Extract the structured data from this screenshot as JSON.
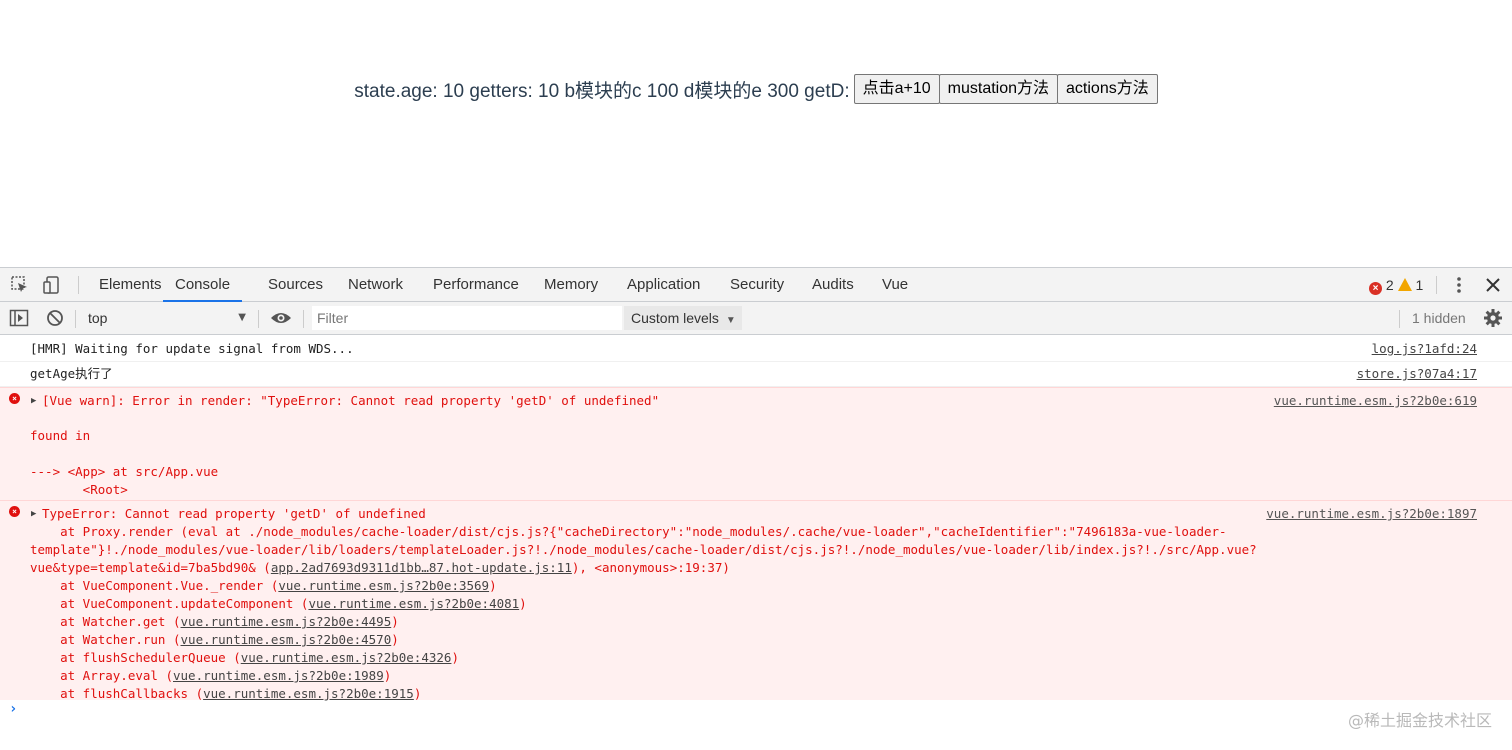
{
  "app": {
    "text": "state.age: 10 getters: 10 b模块的c 100 d模块的e 300 getD:",
    "buttons": [
      "点击a+10",
      "mustation方法",
      "actions方法"
    ]
  },
  "devtools": {
    "tabs": [
      "Elements",
      "Console",
      "Sources",
      "Network",
      "Performance",
      "Memory",
      "Application",
      "Security",
      "Audits",
      "Vue"
    ],
    "active_tab": "Console",
    "issues": {
      "errors": "2",
      "warnings": "1"
    },
    "toolbar": {
      "context": "top",
      "filter_placeholder": "Filter",
      "levels": "Custom levels",
      "hidden": "1 hidden"
    },
    "colors": {
      "error": "#e0100e",
      "error_bg": "#fff0f0",
      "accent": "#1a73e8",
      "warning": "#f2a600"
    },
    "messages": [
      {
        "type": "log",
        "text": "[HMR] Waiting for update signal from WDS...",
        "source": "log.js?1afd:24"
      },
      {
        "type": "log",
        "text": "getAge执行了",
        "source": "store.js?07a4:17"
      },
      {
        "type": "error",
        "text": "[Vue warn]: Error in render: \"TypeError: Cannot read property 'getD' of undefined\"",
        "source": "vue.runtime.esm.js?2b0e:619",
        "found_in": "found in",
        "trace_1": "---> <App> at src/App.vue",
        "trace_2": "       <Root>"
      },
      {
        "type": "error",
        "text": "TypeError: Cannot read property 'getD' of undefined",
        "source": "vue.runtime.esm.js?2b0e:1897",
        "proxy_line_1": "    at Proxy.render (eval at ./node_modules/cache-loader/dist/cjs.js?{\"cacheDirectory\":\"node_modules/.cache/vue-loader\",\"cacheIdentifier\":\"7496183a-vue-loader-",
        "proxy_line_2": "template\"}!./node_modules/vue-loader/lib/loaders/templateLoader.js?!./node_modules/cache-loader/dist/cjs.js?!./node_modules/vue-loader/lib/index.js?!./src/App.vue?",
        "proxy_line_3_pre": "vue&type=template&id=7ba5bd90& (",
        "proxy_line_3_link": "app.2ad7693d9311d1bb…87.hot-update.js:11",
        "proxy_line_3_post": "), <anonymous>:19:37)",
        "stack": [
          {
            "pre": "    at VueComponent.Vue._render (",
            "link": "vue.runtime.esm.js?2b0e:3569",
            "post": ")"
          },
          {
            "pre": "    at VueComponent.updateComponent (",
            "link": "vue.runtime.esm.js?2b0e:4081",
            "post": ")"
          },
          {
            "pre": "    at Watcher.get (",
            "link": "vue.runtime.esm.js?2b0e:4495",
            "post": ")"
          },
          {
            "pre": "    at Watcher.run (",
            "link": "vue.runtime.esm.js?2b0e:4570",
            "post": ")"
          },
          {
            "pre": "    at flushSchedulerQueue (",
            "link": "vue.runtime.esm.js?2b0e:4326",
            "post": ")"
          },
          {
            "pre": "    at Array.eval (",
            "link": "vue.runtime.esm.js?2b0e:1989",
            "post": ")"
          },
          {
            "pre": "    at flushCallbacks (",
            "link": "vue.runtime.esm.js?2b0e:1915",
            "post": ")"
          }
        ]
      }
    ],
    "prompt": "›"
  },
  "watermark": "@稀土掘金技术社区"
}
